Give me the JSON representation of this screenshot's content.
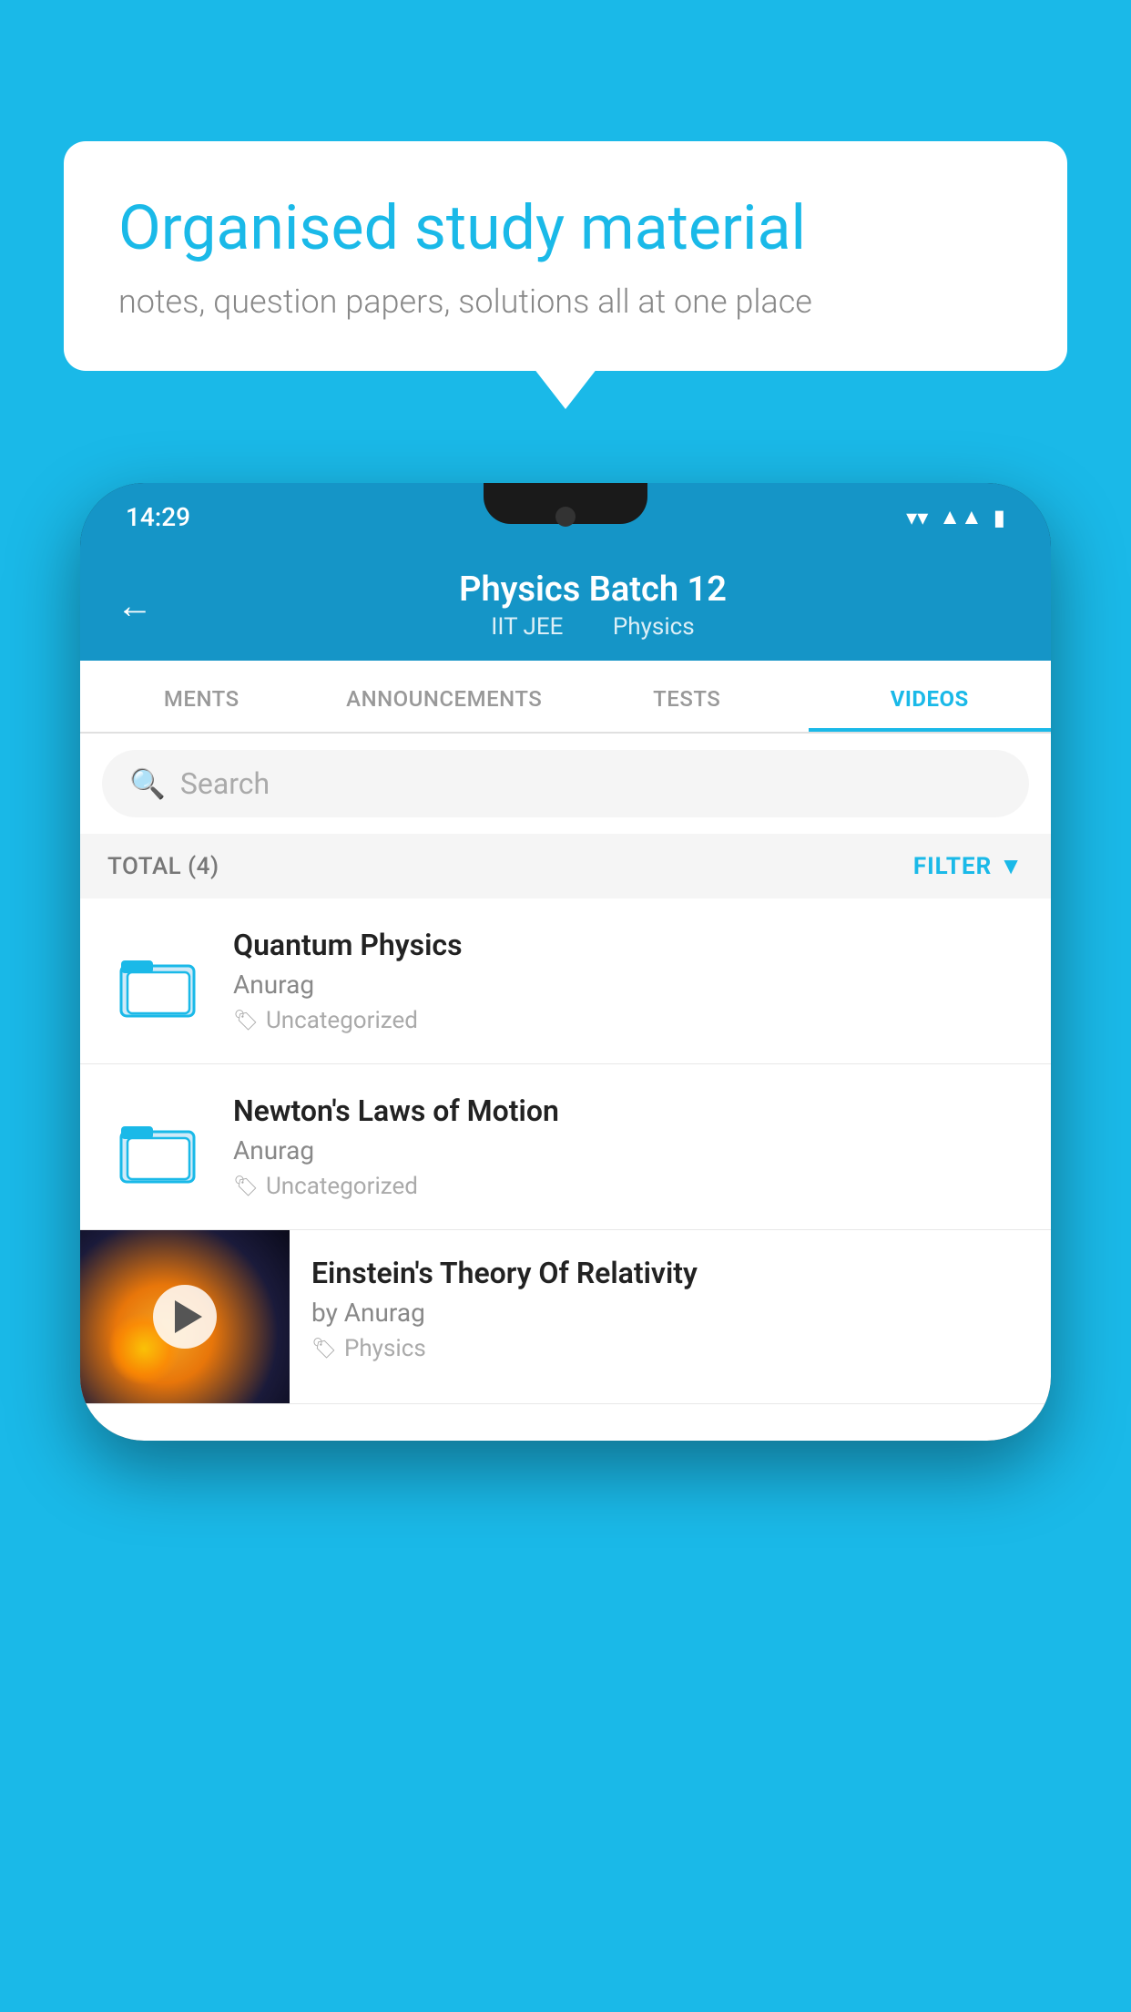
{
  "background": {
    "color": "#1ab9e8"
  },
  "speech_bubble": {
    "heading": "Organised study material",
    "subtext": "notes, question papers, solutions all at one place"
  },
  "phone": {
    "status_bar": {
      "time": "14:29"
    },
    "header": {
      "title": "Physics Batch 12",
      "subtitle_part1": "IIT JEE",
      "subtitle_part2": "Physics",
      "back_label": "←"
    },
    "tabs": [
      {
        "label": "MENTS",
        "active": false
      },
      {
        "label": "ANNOUNCEMENTS",
        "active": false
      },
      {
        "label": "TESTS",
        "active": false
      },
      {
        "label": "VIDEOS",
        "active": true
      }
    ],
    "search": {
      "placeholder": "Search"
    },
    "filter_row": {
      "total_label": "TOTAL (4)",
      "filter_label": "FILTER"
    },
    "videos": [
      {
        "id": "quantum-physics",
        "title": "Quantum Physics",
        "author": "Anurag",
        "tag": "Uncategorized",
        "has_thumbnail": false
      },
      {
        "id": "newtons-laws",
        "title": "Newton's Laws of Motion",
        "author": "Anurag",
        "tag": "Uncategorized",
        "has_thumbnail": false
      },
      {
        "id": "einstein-relativity",
        "title": "Einstein's Theory Of Relativity",
        "author": "by Anurag",
        "tag": "Physics",
        "has_thumbnail": true
      }
    ]
  }
}
